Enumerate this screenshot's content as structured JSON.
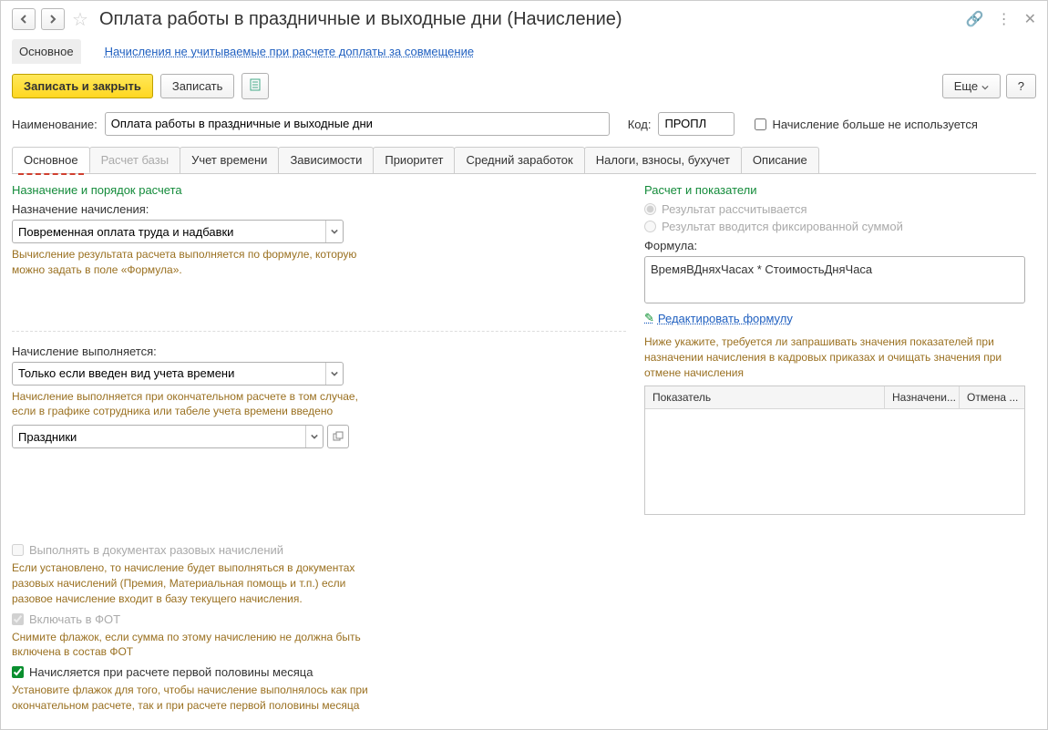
{
  "titlebar": {
    "title": "Оплата работы в праздничные и выходные дни (Начисление)"
  },
  "nav": {
    "main": "Основное",
    "link": "Начисления не учитываемые при расчете доплаты за совмещение"
  },
  "buttons": {
    "save_close": "Записать и закрыть",
    "save": "Записать",
    "more": "Еще",
    "help": "?"
  },
  "fields": {
    "name_label": "Наименование:",
    "name_value": "Оплата работы в праздничные и выходные дни",
    "code_label": "Код:",
    "code_value": "ПРОПЛ",
    "not_used": "Начисление больше не используется"
  },
  "tabs": [
    "Основное",
    "Расчет базы",
    "Учет времени",
    "Зависимости",
    "Приоритет",
    "Средний заработок",
    "Налоги, взносы, бухучет",
    "Описание"
  ],
  "left": {
    "section": "Назначение и порядок расчета",
    "purpose_label": "Назначение начисления:",
    "purpose_value": "Повременная оплата труда и надбавки",
    "purpose_hint": "Вычисление результата расчета выполняется по формуле, которую можно задать в поле «Формула».",
    "exec_label": "Начисление выполняется:",
    "exec_value": "Только если введен вид учета времени",
    "exec_hint": "Начисление выполняется при окончательном расчете в том случае, если в графике сотрудника или табеле учета времени введено",
    "exec_type": "Праздники",
    "cb1": "Выполнять в документах разовых начислений",
    "cb1_hint": "Если установлено, то начисление будет выполняться в документах разовых начислений (Премия, Материальная помощь и т.п.) если разовое начисление входит в базу текущего начисления.",
    "cb2": "Включать в ФОТ",
    "cb2_hint": "Снимите флажок, если сумма по этому начислению не должна быть включена в состав ФОТ",
    "cb3": "Начисляется при расчете первой половины месяца",
    "cb3_hint": "Установите флажок для того, чтобы начисление выполнялось как при окончательном расчете, так и при расчете первой половины месяца"
  },
  "right": {
    "section": "Расчет и показатели",
    "r1": "Результат рассчитывается",
    "r2": "Результат вводится фиксированной суммой",
    "formula_label": "Формула:",
    "formula_value": "ВремяВДняхЧасах * СтоимостьДняЧаса",
    "edit": "Редактировать формулу",
    "grid_hint": "Ниже укажите, требуется ли запрашивать значения показателей при назначении начисления в кадровых приказах и очищать значения при отмене начисления",
    "gh1": "Показатель",
    "gh2": "Назначени...",
    "gh3": "Отмена ..."
  }
}
